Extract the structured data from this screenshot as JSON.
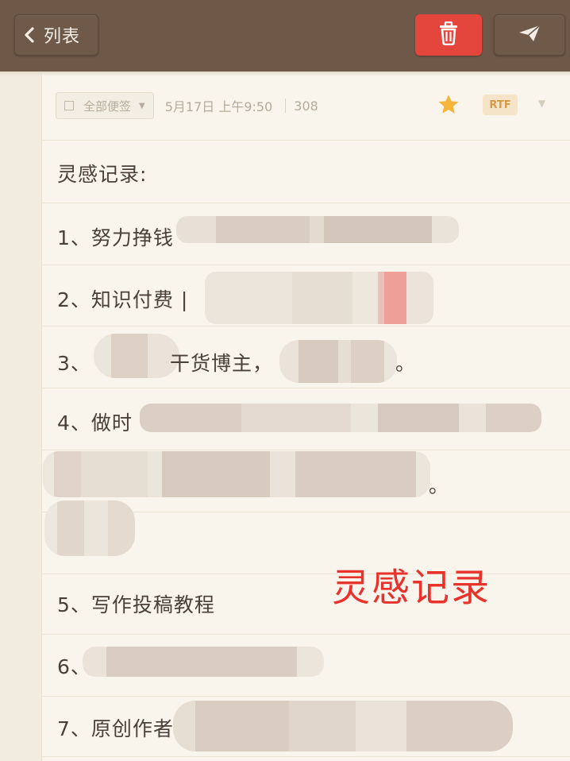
{
  "toolbar": {
    "back_label": "列表",
    "back_icon": "chevron-left-icon",
    "delete_icon": "trash-icon",
    "send_icon": "paper-plane-icon",
    "delete_color": "#e4453d"
  },
  "meta": {
    "folder": "全部便签",
    "date": "5月17日 上午9:50",
    "count": "308",
    "starred": true,
    "format": "RTF"
  },
  "note": {
    "heading": "灵感记录:",
    "items": [
      "1、努力挣钱",
      "2、知识付费 |",
      "3、",
      "4、做时",
      "5、写作投稿教程",
      "6、",
      "7、原创作者"
    ],
    "fragments": {
      "item3_mid": "干货博主，",
      "item3_end": "。",
      "item4_end": "。"
    }
  },
  "watermark": "灵感记录"
}
